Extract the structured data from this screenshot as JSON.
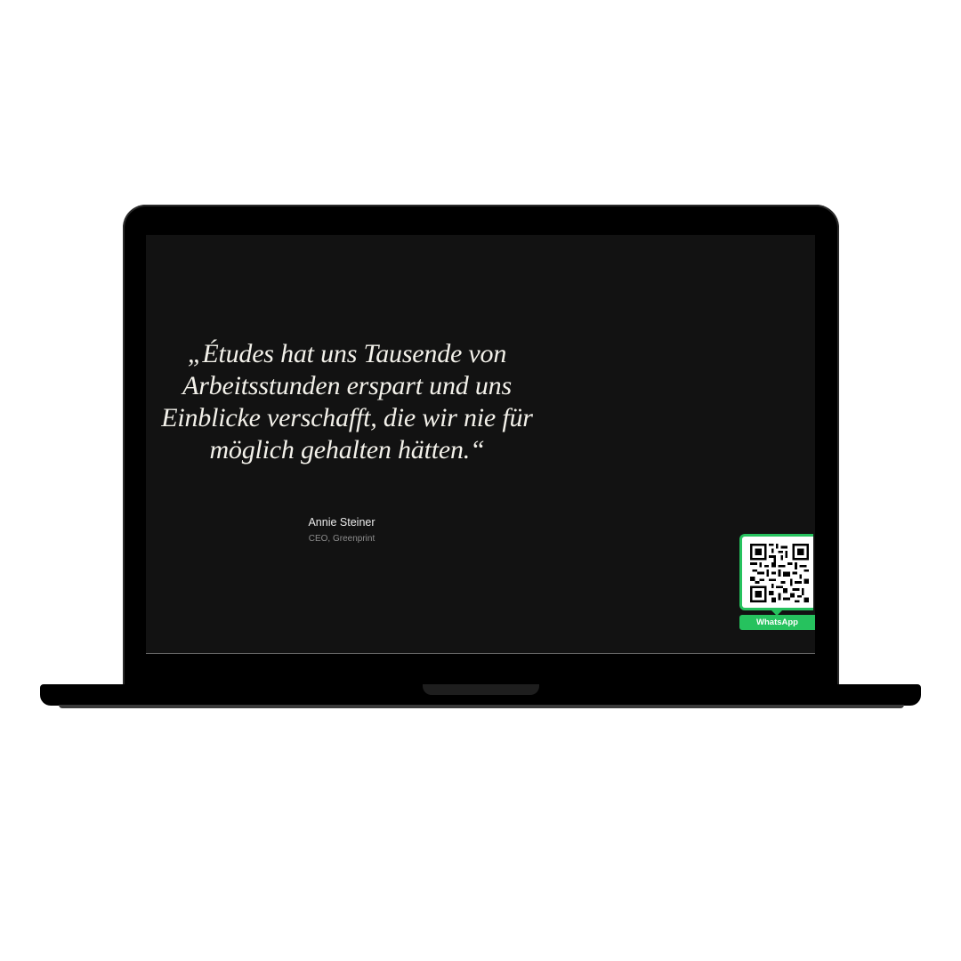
{
  "testimonial": {
    "quote_lines": [
      "„Études hat uns Tausende von",
      "Arbeitsstunden erspart und uns",
      "Einblicke verschafft, die wir nie für",
      "möglich gehalten hätten.“"
    ],
    "author_name": "Annie Steiner",
    "author_role": "CEO, Greenprint"
  },
  "whatsapp_widget": {
    "label": "WhatsApp",
    "icon": "qr-code-icon",
    "accent_color": "#26c25e"
  },
  "colors": {
    "screen_background": "#121212",
    "quote_text": "#f3f1ea",
    "device_body": "#000000"
  }
}
